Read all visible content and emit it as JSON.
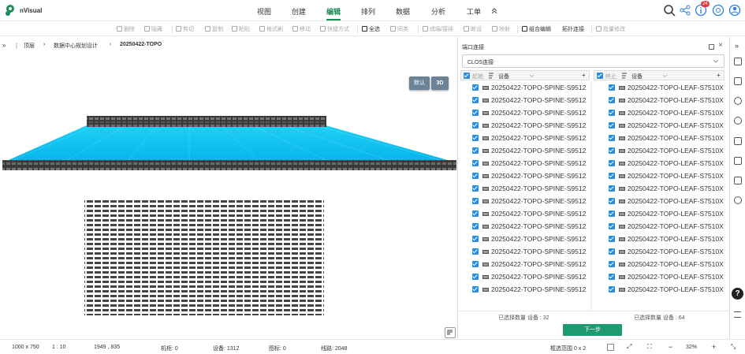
{
  "app": {
    "name": "nVisual",
    "brand_color": "#1e8a5a"
  },
  "nav": {
    "tabs": [
      "视图",
      "创建",
      "编辑",
      "排列",
      "数据",
      "分析",
      "工单"
    ],
    "active": "编辑",
    "notification_count": "24"
  },
  "toolbar": {
    "items": [
      "删除",
      "隐藏",
      "剪切",
      "复制",
      "粘贴",
      "格式刷",
      "移动",
      "快捷方式",
      "全选",
      "同类",
      "成端/接续",
      "断设",
      "映射",
      "组合编辑",
      "拓扑连接",
      "批量修改"
    ]
  },
  "breadcrumb": [
    "顶层",
    "数据中心规划设计",
    "20250422-TOPO"
  ],
  "canvas": {
    "view_default": "默认",
    "view_3d": "3D"
  },
  "panel": {
    "title": "端口连接",
    "mode_select": "CLOS连接",
    "left": {
      "start_label": "起始",
      "device_label": "设备",
      "plus": "+",
      "items": [
        "20250422-TOPO-SPINE-S9512",
        "20250422-TOPO-SPINE-S9512",
        "20250422-TOPO-SPINE-S9512",
        "20250422-TOPO-SPINE-S9512",
        "20250422-TOPO-SPINE-S9512",
        "20250422-TOPO-SPINE-S9512",
        "20250422-TOPO-SPINE-S9512",
        "20250422-TOPO-SPINE-S9512",
        "20250422-TOPO-SPINE-S9512",
        "20250422-TOPO-SPINE-S9512",
        "20250422-TOPO-SPINE-S9512",
        "20250422-TOPO-SPINE-S9512",
        "20250422-TOPO-SPINE-S9512",
        "20250422-TOPO-SPINE-S9512",
        "20250422-TOPO-SPINE-S9512",
        "20250422-TOPO-SPINE-S9512",
        "20250422-TOPO-SPINE-S9512"
      ]
    },
    "right": {
      "end_label": "终止",
      "device_label": "设备",
      "plus": "+",
      "items": [
        "20250422-TOPO-LEAF-S7510X",
        "20250422-TOPO-LEAF-S7510X",
        "20250422-TOPO-LEAF-S7510X",
        "20250422-TOPO-LEAF-S7510X",
        "20250422-TOPO-LEAF-S7510X",
        "20250422-TOPO-LEAF-S7510X",
        "20250422-TOPO-LEAF-S7510X",
        "20250422-TOPO-LEAF-S7510X",
        "20250422-TOPO-LEAF-S7510X",
        "20250422-TOPO-LEAF-S7510X",
        "20250422-TOPO-LEAF-S7510X",
        "20250422-TOPO-LEAF-S7510X",
        "20250422-TOPO-LEAF-S7510X",
        "20250422-TOPO-LEAF-S7510X",
        "20250422-TOPO-LEAF-S7510X",
        "20250422-TOPO-LEAF-S7510X",
        "20250422-TOPO-LEAF-S7510X"
      ]
    },
    "selected_left": "已选择数量 设备 : 32",
    "selected_right": "已选择数量 设备 : 64",
    "next": "下一步"
  },
  "status": {
    "resolution": "1000 x 750",
    "scale": "1 : 10",
    "coords": "1949 , 835",
    "racks": "机柜: 0",
    "devices": "设备: 1312",
    "icons": "图标: 0",
    "lines": "线路: 2048",
    "selection": "框选范围 0 x 2",
    "zoom": "32%"
  }
}
